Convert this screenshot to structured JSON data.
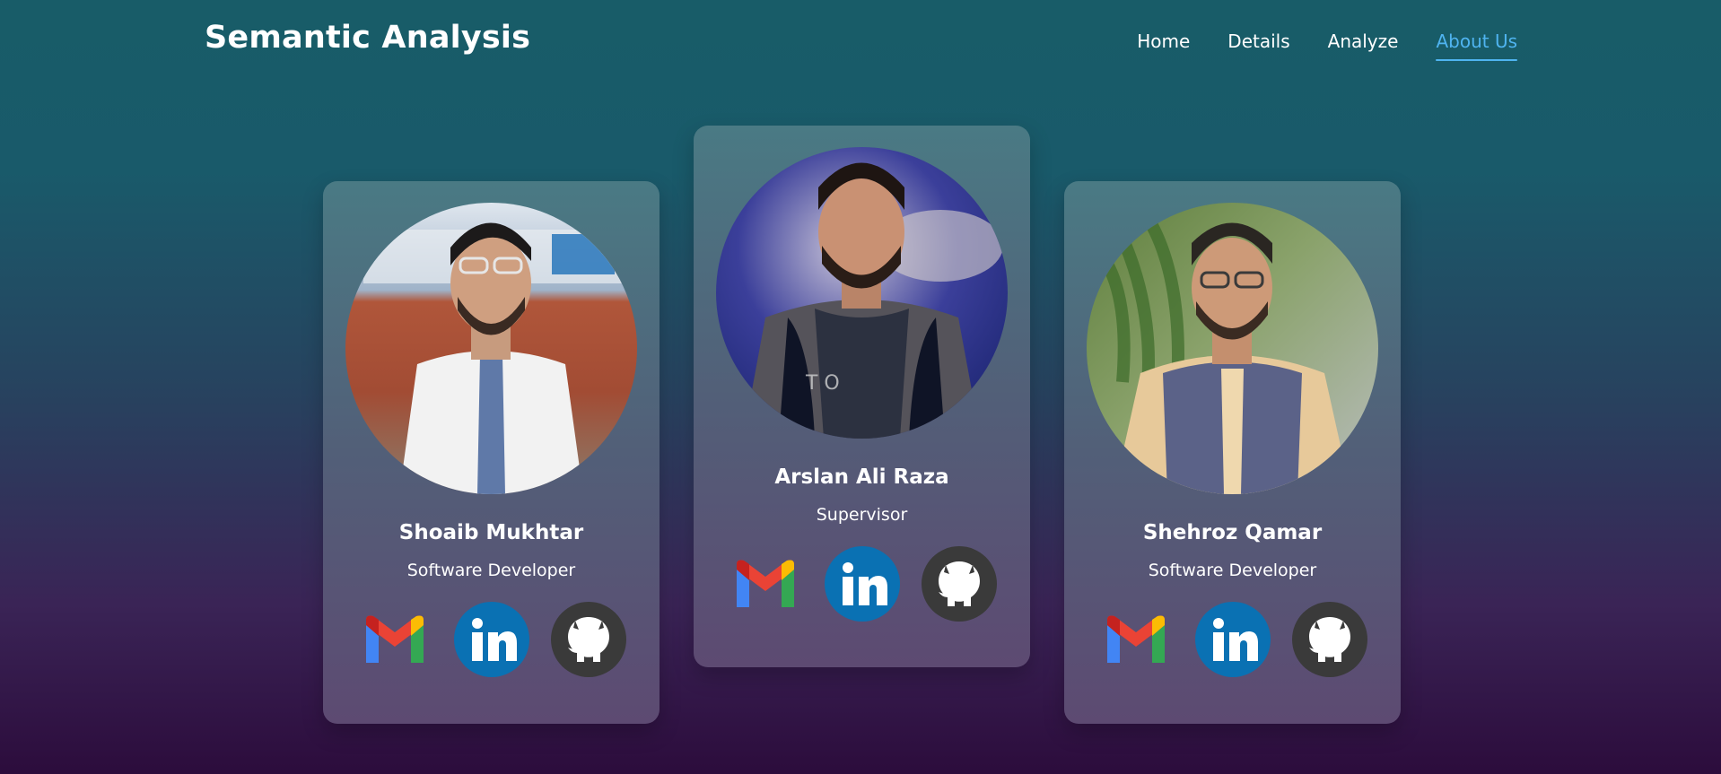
{
  "header": {
    "brand": "Semantic Analysis",
    "nav": [
      {
        "label": "Home",
        "active": false
      },
      {
        "label": "Details",
        "active": false
      },
      {
        "label": "Analyze",
        "active": false
      },
      {
        "label": "About Us",
        "active": true
      }
    ]
  },
  "team": [
    {
      "name": "Shoaib Mukhtar",
      "role": "Software Developer",
      "socials": [
        "gmail-icon",
        "linkedin-icon",
        "github-icon"
      ]
    },
    {
      "name": "Arslan Ali Raza",
      "role": "Supervisor",
      "socials": [
        "gmail-icon",
        "linkedin-icon",
        "github-icon"
      ]
    },
    {
      "name": "Shehroz Qamar",
      "role": "Software Developer",
      "socials": [
        "gmail-icon",
        "linkedin-icon",
        "github-icon"
      ]
    }
  ],
  "colors": {
    "accent": "#4fb4f0",
    "linkedin": "#0a71b3",
    "github": "#3a3a3a",
    "gmail_red": "#ea4335",
    "gmail_blue": "#4285f4",
    "gmail_green": "#34a853",
    "gmail_yellow": "#fbbc04"
  }
}
